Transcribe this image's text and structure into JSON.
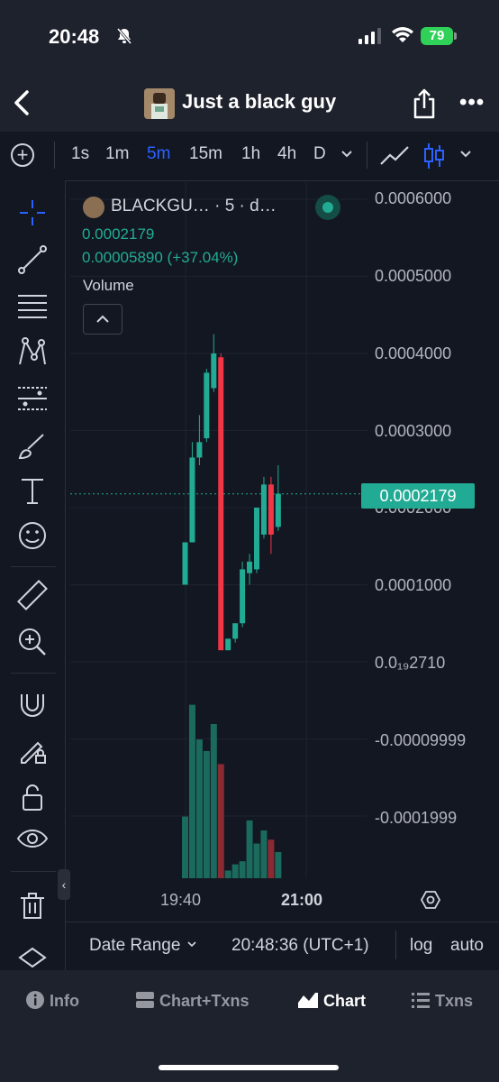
{
  "status": {
    "time": "20:48",
    "battery": "79"
  },
  "header": {
    "title": "Just a black guy"
  },
  "timeframes": [
    "1s",
    "1m",
    "5m",
    "15m",
    "1h",
    "4h",
    "D"
  ],
  "active_timeframe": "5m",
  "legend": {
    "symbol": "BLACKGU… · 5 · d…",
    "price": "0.0002179",
    "change": "0.00005890 (+37.04%)",
    "volume_label": "Volume"
  },
  "price_axis": {
    "labels": [
      "0.0006000",
      "0.0005000",
      "0.0004000",
      "0.0003000",
      "0.0002000",
      "0.0001000",
      "0.0₁₉2710",
      "-0.00009999",
      "-0.0001999"
    ],
    "current_price": "0.0002179"
  },
  "time_axis": {
    "labels": [
      "19:40",
      "21:00"
    ]
  },
  "bottom_controls": {
    "date_range": "Date Range",
    "time": "20:48:36 (UTC+1)",
    "log": "log",
    "auto": "auto"
  },
  "tabs": [
    {
      "label": "Info",
      "icon": "info-icon"
    },
    {
      "label": "Chart+Txns",
      "icon": "chart-txns-icon"
    },
    {
      "label": "Chart",
      "icon": "chart-icon"
    },
    {
      "label": "Txns",
      "icon": "list-icon"
    }
  ],
  "active_tab": "Chart",
  "colors": {
    "up": "#22ab94",
    "down": "#f23645",
    "accent": "#2962ff",
    "background": "#131722"
  },
  "chart_data": {
    "type": "candlestick",
    "candles": [
      {
        "o": 0.0001,
        "h": 0.0001,
        "l": 0.0001,
        "c": 0.000155
      },
      {
        "o": 0.000155,
        "h": 0.000285,
        "l": 0.000155,
        "c": 0.000265
      },
      {
        "o": 0.000265,
        "h": 0.00032,
        "l": 0.000255,
        "c": 0.000285
      },
      {
        "o": 0.00029,
        "h": 0.00038,
        "l": 0.000285,
        "c": 0.000375
      },
      {
        "o": 0.000355,
        "h": 0.000425,
        "l": 0.00035,
        "c": 0.0004
      },
      {
        "o": 0.000395,
        "h": 0.0004,
        "l": 1.5e-05,
        "c": 1.5e-05
      },
      {
        "o": 1.5e-05,
        "h": 3e-05,
        "l": 1.5e-05,
        "c": 3e-05
      },
      {
        "o": 3e-05,
        "h": 5e-05,
        "l": 2.5e-05,
        "c": 5e-05
      },
      {
        "o": 5e-05,
        "h": 0.00013,
        "l": 4.5e-05,
        "c": 0.00012
      },
      {
        "o": 0.000115,
        "h": 0.00014,
        "l": 0.0001,
        "c": 0.00013
      },
      {
        "o": 0.00012,
        "h": 0.0002,
        "l": 0.000115,
        "c": 0.0002
      },
      {
        "o": 0.000165,
        "h": 0.00024,
        "l": 0.00016,
        "c": 0.00023
      },
      {
        "o": 0.00023,
        "h": 0.00024,
        "l": 0.00014,
        "c": 0.000165
      },
      {
        "o": 0.000175,
        "h": 0.000255,
        "l": 0.00017,
        "c": 0.000218
      }
    ],
    "volume": [
      {
        "v": 8e-05,
        "up": true
      },
      {
        "v": 0.000225,
        "up": true
      },
      {
        "v": 0.00018,
        "up": true
      },
      {
        "v": 0.000165,
        "up": true
      },
      {
        "v": 0.0002,
        "up": true
      },
      {
        "v": 0.000148,
        "up": false
      },
      {
        "v": 1e-05,
        "up": true
      },
      {
        "v": 1.8e-05,
        "up": true
      },
      {
        "v": 2.2e-05,
        "up": true
      },
      {
        "v": 7.5e-05,
        "up": true
      },
      {
        "v": 4.5e-05,
        "up": true
      },
      {
        "v": 6.2e-05,
        "up": true
      },
      {
        "v": 5e-05,
        "up": false
      },
      {
        "v": 3.4e-05,
        "up": true
      }
    ],
    "ylim": [
      -0.00025,
      0.00065
    ]
  }
}
